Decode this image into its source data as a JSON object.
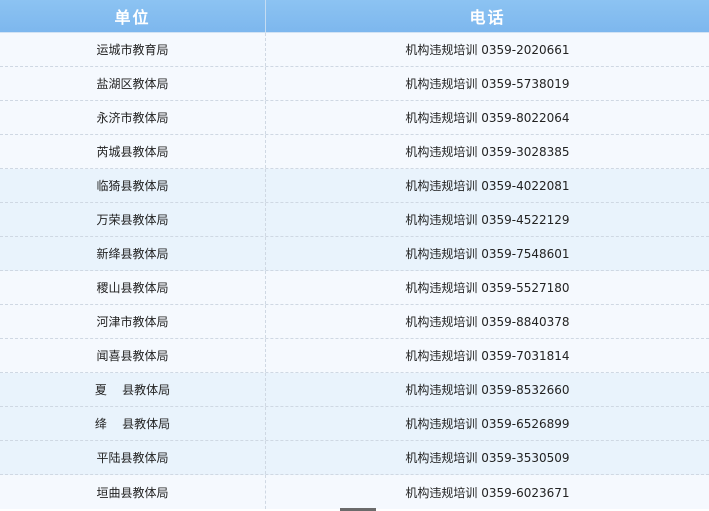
{
  "table": {
    "headers": [
      "单位",
      "电话"
    ],
    "rows": [
      [
        "运城市教育局",
        "机构违规培训 0359-2020661"
      ],
      [
        "盐湖区教体局",
        "机构违规培训 0359-5738019"
      ],
      [
        "永济市教体局",
        "机构违规培训 0359-8022064"
      ],
      [
        "芮城县教体局",
        "机构违规培训 0359-3028385"
      ],
      [
        "临猗县教体局",
        "机构违规培训 0359-4022081"
      ],
      [
        "万荣县教体局",
        "机构违规培训 0359-4522129"
      ],
      [
        "新绛县教体局",
        "机构违规培训 0359-7548601"
      ],
      [
        "稷山县教体局",
        "机构违规培训 0359-5527180"
      ],
      [
        "河津市教体局",
        "机构违规培训 0359-8840378"
      ],
      [
        "闻喜县教体局",
        "机构违规培训 0359-7031814"
      ],
      [
        "夏    县教体局",
        "机构违规培训 0359-8532660"
      ],
      [
        "绛    县教体局",
        "机构违规培训 0359-6526899"
      ],
      [
        "平陆县教体局",
        "机构违规培训 0359-3530509"
      ],
      [
        "垣曲县教体局",
        "机构违规培训 0359-6023671"
      ]
    ]
  },
  "colors": {
    "header_bg": "#8cc3f2",
    "row_alt_bg": "#e9f3fc",
    "row_bg": "#f5f9fe"
  }
}
